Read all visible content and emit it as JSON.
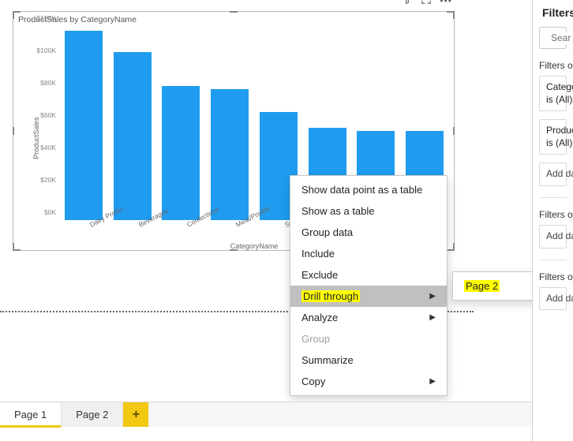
{
  "visual": {
    "title": "ProductSales by CategoryName",
    "toolbar_icons": [
      "filter-icon",
      "focus-icon",
      "more-icon"
    ]
  },
  "chart_data": {
    "type": "bar",
    "title": "ProductSales by CategoryName",
    "xlabel": "CategoryName",
    "ylabel": "ProductSales",
    "ylim": [
      0,
      120000
    ],
    "y_ticks": [
      "$0K",
      "$20K",
      "$40K",
      "$60K",
      "$80K",
      "$100K",
      "$120K"
    ],
    "categories": [
      "Dairy Produ…",
      "Beverages",
      "Confections",
      "Meat/Poultry",
      "Seafood",
      "",
      "",
      ""
    ],
    "values": [
      117000,
      104000,
      83000,
      81000,
      67000,
      57000,
      55000,
      55000
    ]
  },
  "context_menu": {
    "items": [
      {
        "label": "Show data point as a table",
        "disabled": false,
        "submenu": false
      },
      {
        "label": "Show as a table",
        "disabled": false,
        "submenu": false
      },
      {
        "label": "Group data",
        "disabled": false,
        "submenu": false
      },
      {
        "label": "Include",
        "disabled": false,
        "submenu": false
      },
      {
        "label": "Exclude",
        "disabled": false,
        "submenu": false
      },
      {
        "label": "Drill through",
        "disabled": false,
        "submenu": true,
        "selected": true,
        "highlight": true
      },
      {
        "label": "Analyze",
        "disabled": false,
        "submenu": true
      },
      {
        "label": "Group",
        "disabled": true,
        "submenu": false
      },
      {
        "label": "Summarize",
        "disabled": false,
        "submenu": false
      },
      {
        "label": "Copy",
        "disabled": false,
        "submenu": true
      }
    ],
    "submenu": {
      "for": "Drill through",
      "items": [
        {
          "label": "Page 2",
          "highlight": true
        }
      ]
    }
  },
  "filters": {
    "title": "Filters",
    "search_placeholder": "Search",
    "section1_label": "Filters on this visual",
    "card1_line1": "CategoryName",
    "card1_line2": "is (All)",
    "card2_line1": "ProductSales",
    "card2_line2": "is (All)",
    "add_label": "Add data fields here",
    "section2_label": "Filters on this page",
    "section3_label": "Filters on all pages"
  },
  "tabs": {
    "items": [
      {
        "label": "Page 1",
        "active": true
      },
      {
        "label": "Page 2",
        "active": false
      }
    ],
    "add_label": "+"
  }
}
